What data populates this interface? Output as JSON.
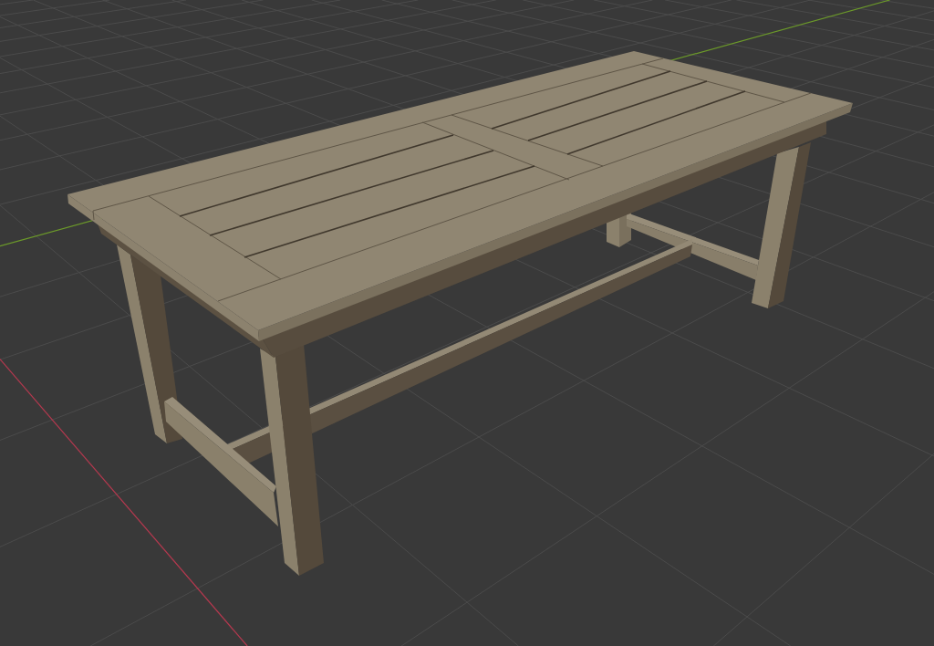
{
  "viewport": {
    "axis_lines": [
      {
        "color": "#b5394f"
      },
      {
        "color": "#6c9a2a"
      }
    ]
  }
}
